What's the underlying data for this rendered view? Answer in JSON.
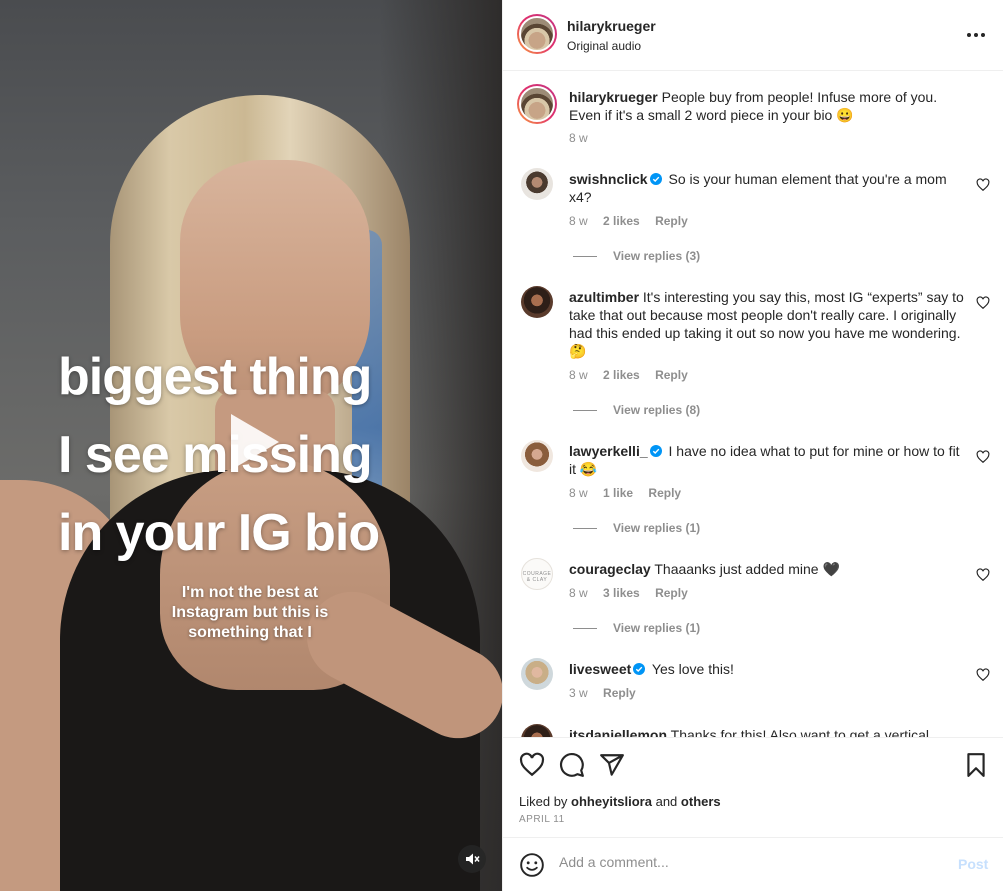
{
  "video": {
    "caption_lines": [
      "biggest thing",
      "I see missing",
      "in your IG bio"
    ],
    "subtitle_lines": [
      "I'm not the best at",
      "Instagram but this is",
      "something that I"
    ],
    "play_icon": "play-icon",
    "mute_icon": "muted-speaker-icon"
  },
  "header": {
    "username": "hilarykrueger",
    "audio": "Original audio",
    "more_icon": "more-options-icon"
  },
  "caption": {
    "username": "hilarykrueger",
    "text": "People buy from people! Infuse more of you. Even if it's a small 2 word piece in your bio 😀",
    "time": "8 w"
  },
  "comments": [
    {
      "username": "swishnclick",
      "verified": true,
      "text": "So is your human element that you're a mom x4?",
      "time": "8 w",
      "likes": "2 likes",
      "reply": "Reply",
      "view_replies": "View replies (3)"
    },
    {
      "username": "azultimber",
      "verified": false,
      "text": "It's interesting you say this, most IG “experts” say to take that out because most people don't really care. I originally had this ended up taking it out so now you have me wondering.🤔",
      "time": "8 w",
      "likes": "2 likes",
      "reply": "Reply",
      "view_replies": "View replies (8)"
    },
    {
      "username": "lawyerkelli_",
      "verified": true,
      "text": "I have no idea what to put for mine or how to fit it 😂",
      "time": "8 w",
      "likes": "1 like",
      "reply": "Reply",
      "view_replies": "View replies (1)"
    },
    {
      "username": "courageclay",
      "verified": false,
      "text": "Thaaanks just added mine 🖤",
      "time": "8 w",
      "likes": "3 likes",
      "reply": "Reply",
      "view_replies": "View replies (1)",
      "avatar_text": "COURAGE & CLAY"
    },
    {
      "username": "livesweet",
      "verified": true,
      "text": "Yes love this!",
      "time": "3 w",
      "likes": "",
      "reply": "Reply",
      "view_replies": ""
    },
    {
      "username": "itsdaniellemon",
      "verified": false,
      "text": "Thanks for this! Also want to get a vertical",
      "time": "",
      "likes": "",
      "reply": "",
      "view_replies": ""
    }
  ],
  "actions": {
    "like_icon": "heart-icon",
    "comment_icon": "comment-icon",
    "share_icon": "share-icon",
    "save_icon": "bookmark-icon",
    "liked_by_prefix": "Liked by",
    "liked_by_user": "ohheyitsliora",
    "liked_by_and": "and",
    "liked_by_others": "others",
    "date": "APRIL 11"
  },
  "add_comment": {
    "placeholder": "Add a comment...",
    "post_label": "Post",
    "emoji_icon": "emoji-icon"
  },
  "colors": {
    "verified_blue": "#0095f6",
    "post_disabled": "#c7e0fd",
    "muted_text": "#8e8e8e"
  }
}
